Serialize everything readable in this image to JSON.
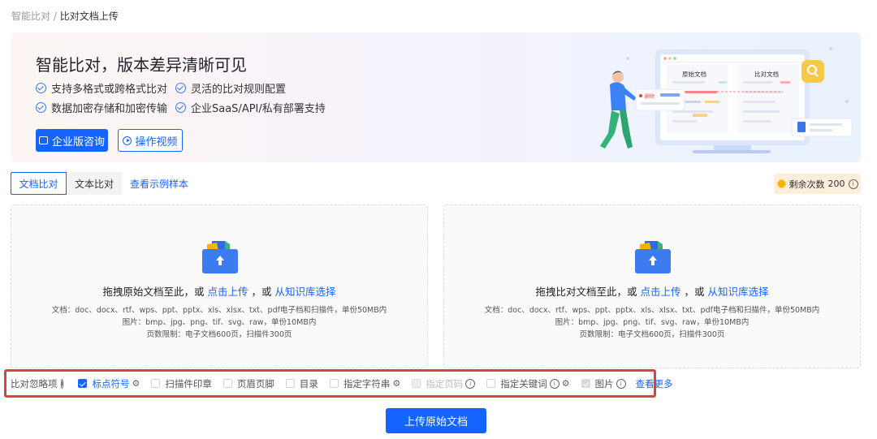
{
  "breadcrumb": {
    "root": "智能比对",
    "sep": "/",
    "current": "比对文档上传"
  },
  "banner": {
    "title": "智能比对，版本差异清晰可见",
    "features": [
      "支持多格式或跨格式比对",
      "灵活的比对规则配置",
      "数据加密存储和加密传输",
      "企业SaaS/API/私有部署支持"
    ],
    "enterprise_button": "企业版咨询",
    "video_button": "操作视频",
    "illustration": {
      "original_label": "原始文档",
      "compare_label": "比对文档",
      "delete_tag": "删除"
    }
  },
  "tabs": {
    "doc_compare": "文档比对",
    "text_compare": "文本比对",
    "sample_link": "查看示例样本"
  },
  "remaining": {
    "label": "剩余次数",
    "count": "200"
  },
  "dropzones": [
    {
      "prefix": "拖拽原始文档至此，或",
      "click_upload": "点击上传",
      "comma": "，或",
      "library": "从知识库选择",
      "line_docs": "文档：doc、docx、rtf、wps、ppt、pptx、xls、xlsx、txt、pdf电子档和扫描件，单份50MB内",
      "line_images": "图片：bmp、jpg、png、tif、svg、raw，单份10MB内",
      "line_pages": "页数限制：电子文档600页，扫描件300页"
    },
    {
      "prefix": "拖拽比对文档至此，或",
      "click_upload": "点击上传",
      "comma": "，或",
      "library": "从知识库选择",
      "line_docs": "文档：doc、docx、rtf、wps、ppt、pptx、xls、xlsx、txt、pdf电子档和扫描件，单份50MB内",
      "line_images": "图片：bmp、jpg、png、tif、svg、raw，单份10MB内",
      "line_pages": "页数限制：电子文档600页，扫描件300页"
    }
  ],
  "ignore_options": {
    "label": "比对忽略项",
    "items": [
      {
        "label": "标点符号",
        "checked": true
      },
      {
        "label": "扫描件印章",
        "checked": false
      },
      {
        "label": "页眉页脚",
        "checked": false
      },
      {
        "label": "目录",
        "checked": false
      },
      {
        "label": "指定字符串",
        "checked": false
      },
      {
        "label": "指定页码",
        "checked": false,
        "disabled": true
      },
      {
        "label": "指定关键词",
        "checked": false
      },
      {
        "label": "图片",
        "checked": true,
        "disabled": true
      }
    ],
    "more_link": "查看更多"
  },
  "upload_button": "上传原始文档",
  "colors": {
    "accent": "#1664ff",
    "highlight_border": "#e0413d",
    "remain_bg": "#fbefdc"
  }
}
